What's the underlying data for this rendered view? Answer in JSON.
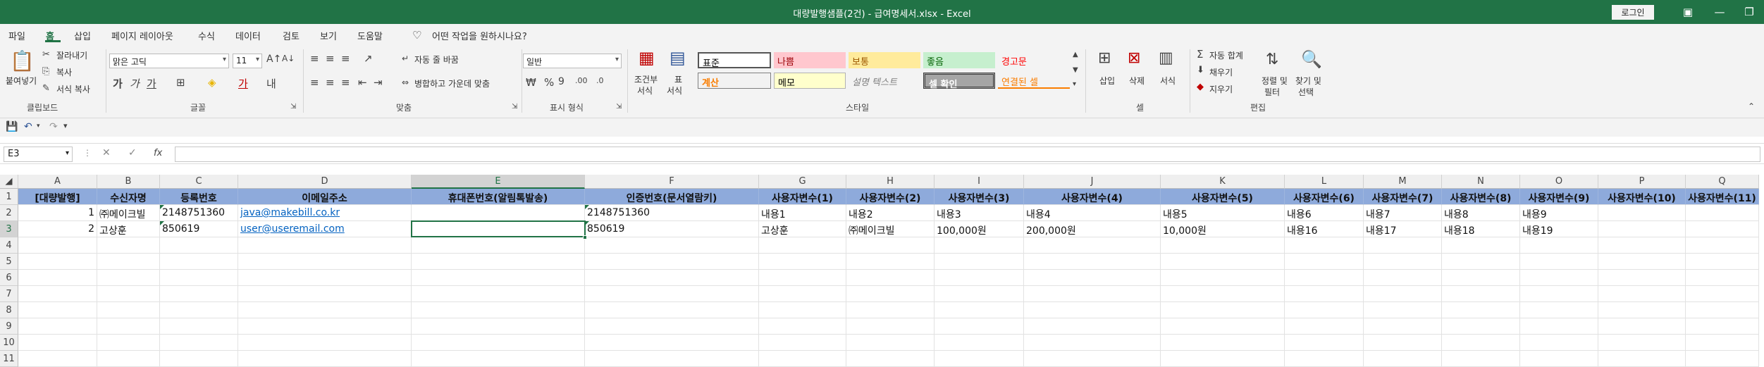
{
  "window": {
    "title": "대량발행샘플(2건) - 급여명세서.xlsx  -  Excel",
    "login_label": "로그인"
  },
  "menu": {
    "items": [
      "파일",
      "홈",
      "삽입",
      "페이지 레이아웃",
      "수식",
      "데이터",
      "검토",
      "보기",
      "도움말"
    ],
    "tell_me": "어떤 작업을 원하시나요?"
  },
  "ribbon": {
    "clipboard": {
      "paste": "붙여넣기",
      "cut": "잘라내기",
      "copy": "복사",
      "format_painter": "서식 복사",
      "label": "클립보드"
    },
    "font": {
      "name": "맑은 고딕",
      "size": "11",
      "label": "글꼴"
    },
    "alignment": {
      "wrap": "자동 줄 바꿈",
      "merge": "병합하고 가운데 맞춤",
      "label": "맞춤"
    },
    "number": {
      "format": "일반",
      "label": "표시 형식"
    },
    "styles": {
      "conditional": "조건부",
      "conditional2": "서식",
      "table": "표",
      "table2": "서식",
      "cells": [
        {
          "text": "표준",
          "bg": "#ffffff",
          "fg": "#000000"
        },
        {
          "text": "나쁨",
          "bg": "#ffc7ce",
          "fg": "#9c0006"
        },
        {
          "text": "보통",
          "bg": "#ffeb9c",
          "fg": "#9c5700"
        },
        {
          "text": "좋음",
          "bg": "#c6efce",
          "fg": "#006100"
        },
        {
          "text": "경고문",
          "bg": "#f3f3f3",
          "fg": "#ff0000"
        },
        {
          "text": "계산",
          "bg": "#f2f2f2",
          "fg": "#fa7d00"
        },
        {
          "text": "메모",
          "bg": "#ffffcc",
          "fg": "#000000"
        },
        {
          "text": "설명 텍스트",
          "bg": "#f3f3f3",
          "fg": "#7f7f7f"
        },
        {
          "text": "셀 확인",
          "bg": "#a5a5a5",
          "fg": "#ffffff"
        },
        {
          "text": "연결된 셀",
          "bg": "#f3f3f3",
          "fg": "#fa7d00"
        }
      ],
      "label": "스타일"
    },
    "cells": {
      "insert": "삽입",
      "delete": "삭제",
      "format": "서식",
      "label": "셀"
    },
    "editing": {
      "autosum": "자동 합계",
      "fill": "채우기",
      "clear": "지우기",
      "sort": "정렬 및",
      "sort2": "필터",
      "find": "찾기 및",
      "find2": "선택",
      "label": "편집"
    }
  },
  "formula_bar": {
    "name_box": "E3",
    "fx": "fx",
    "value": ""
  },
  "columns": [
    "A",
    "B",
    "C",
    "D",
    "E",
    "F",
    "G",
    "H",
    "I",
    "J",
    "K",
    "L",
    "M",
    "N",
    "O",
    "P",
    "Q"
  ],
  "rows": [
    "1",
    "2",
    "3",
    "4",
    "5",
    "6",
    "7",
    "8",
    "9",
    "10",
    "11"
  ],
  "table": {
    "header": [
      "[대량발행]",
      "수신자명",
      "등록번호",
      "이메일주소",
      "휴대폰번호(알림톡발송)",
      "인증번호(문서열람키)",
      "사용자변수(1)",
      "사용자변수(2)",
      "사용자변수(3)",
      "사용자변수(4)",
      "사용자변수(5)",
      "사용자변수(6)",
      "사용자변수(7)",
      "사용자변수(8)",
      "사용자변수(9)",
      "사용자변수(10)",
      "사용자변수(11)"
    ],
    "data": [
      [
        "1",
        "㈜메이크빌",
        "2148751360",
        "java@makebill.co.kr",
        "",
        "2148751360",
        "내용1",
        "내용2",
        "내용3",
        "내용4",
        "내용5",
        "내용6",
        "내용7",
        "내용8",
        "내용9",
        "",
        ""
      ],
      [
        "2",
        "고상훈",
        "850619",
        "user@useremail.com",
        "",
        "850619",
        "고상훈",
        "㈜메이크빌",
        "100,000원",
        "200,000원",
        "10,000원",
        "내용16",
        "내용17",
        "내용18",
        "내용19",
        "",
        ""
      ]
    ]
  },
  "accent": "#217346"
}
